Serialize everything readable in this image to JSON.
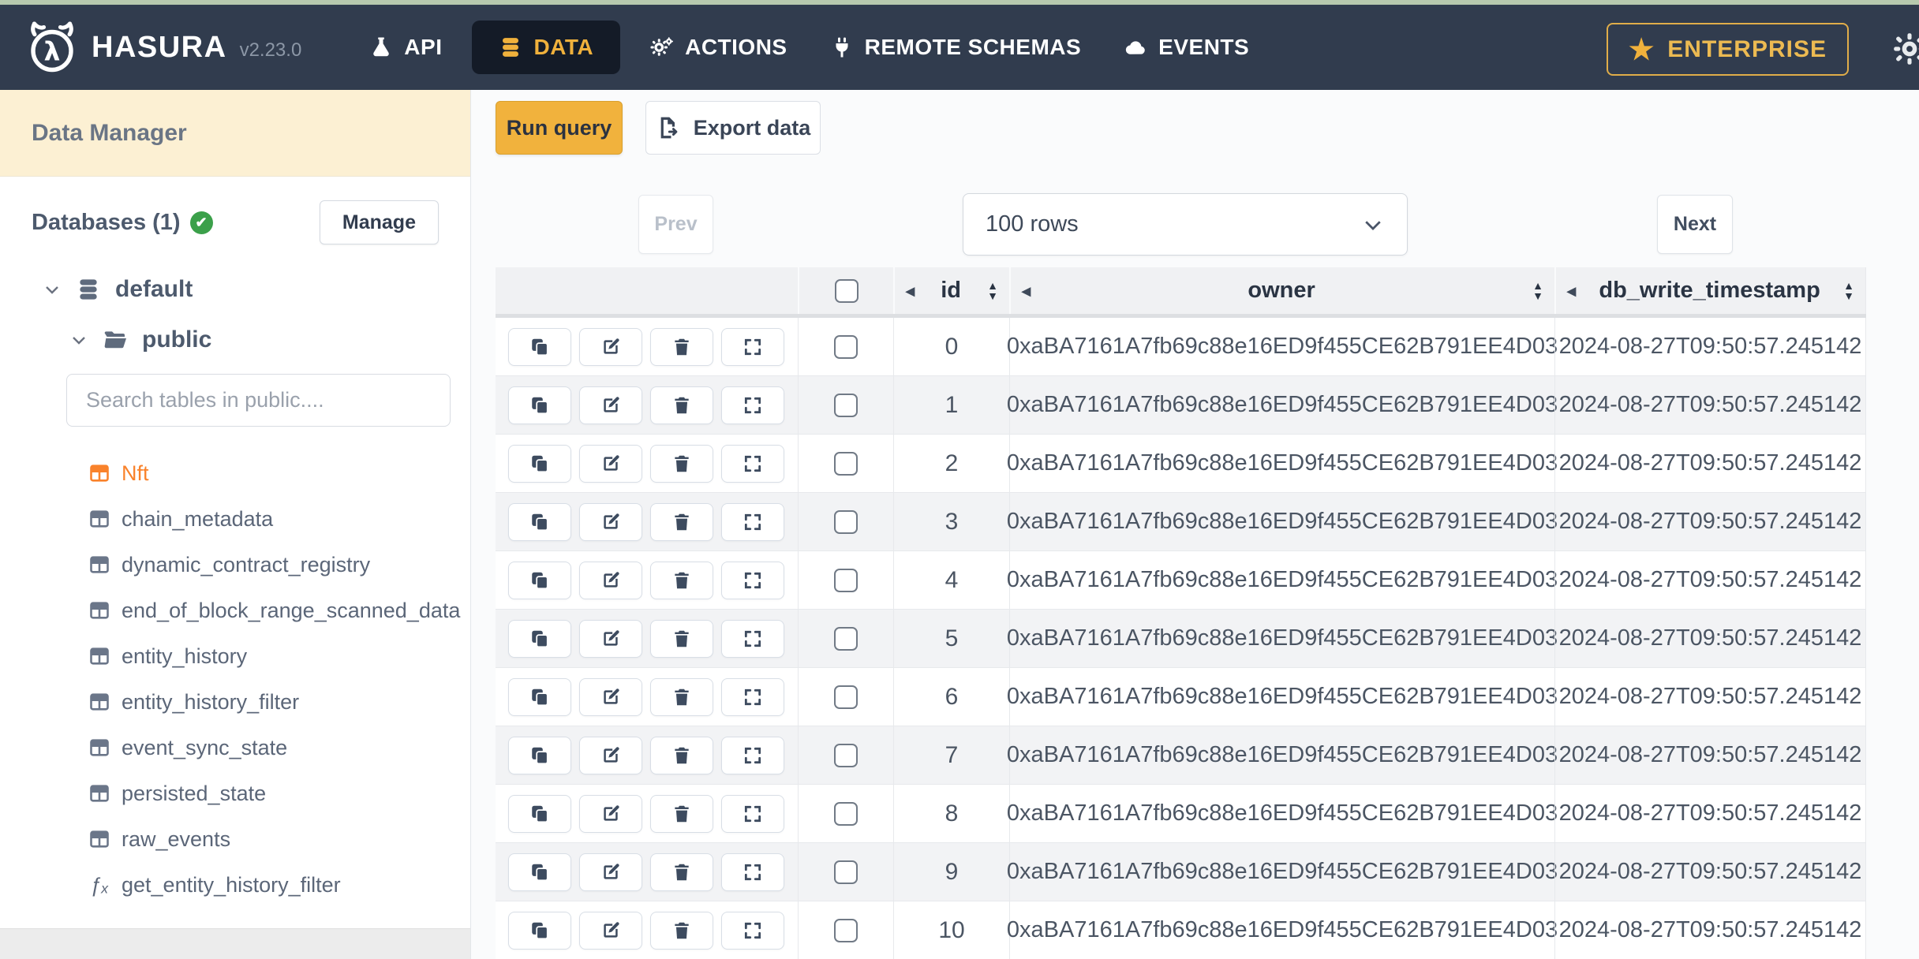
{
  "navbar": {
    "brand": "HASURA",
    "version": "v2.23.0",
    "items": [
      {
        "label": "API"
      },
      {
        "label": "DATA"
      },
      {
        "label": "ACTIONS"
      },
      {
        "label": "REMOTE SCHEMAS"
      },
      {
        "label": "EVENTS"
      }
    ],
    "enterprise_label": "ENTERPRISE"
  },
  "sidebar": {
    "title": "Data Manager",
    "databases_label": "Databases (1)",
    "manage_button": "Manage",
    "tree": {
      "database": "default",
      "schema": "public"
    },
    "search_placeholder": "Search tables in public....",
    "tables": [
      "Nft",
      "chain_metadata",
      "dynamic_contract_registry",
      "end_of_block_range_scanned_data",
      "entity_history",
      "entity_history_filter",
      "event_sync_state",
      "persisted_state",
      "raw_events"
    ],
    "selected_table": "Nft",
    "function_item": "get_entity_history_filter"
  },
  "toolbar": {
    "run_query": "Run query",
    "export_data": "Export data"
  },
  "pagination": {
    "prev": "Prev",
    "rows_select": "100 rows",
    "next": "Next"
  },
  "table": {
    "columns": [
      "id",
      "owner",
      "db_write_timestamp"
    ],
    "rows": [
      {
        "id": "0",
        "owner": "0xaBA7161A7fb69c88e16ED9f455CE62B791EE4D03",
        "db_write_timestamp": "2024-08-27T09:50:57.245142"
      },
      {
        "id": "1",
        "owner": "0xaBA7161A7fb69c88e16ED9f455CE62B791EE4D03",
        "db_write_timestamp": "2024-08-27T09:50:57.245142"
      },
      {
        "id": "2",
        "owner": "0xaBA7161A7fb69c88e16ED9f455CE62B791EE4D03",
        "db_write_timestamp": "2024-08-27T09:50:57.245142"
      },
      {
        "id": "3",
        "owner": "0xaBA7161A7fb69c88e16ED9f455CE62B791EE4D03",
        "db_write_timestamp": "2024-08-27T09:50:57.245142"
      },
      {
        "id": "4",
        "owner": "0xaBA7161A7fb69c88e16ED9f455CE62B791EE4D03",
        "db_write_timestamp": "2024-08-27T09:50:57.245142"
      },
      {
        "id": "5",
        "owner": "0xaBA7161A7fb69c88e16ED9f455CE62B791EE4D03",
        "db_write_timestamp": "2024-08-27T09:50:57.245142"
      },
      {
        "id": "6",
        "owner": "0xaBA7161A7fb69c88e16ED9f455CE62B791EE4D03",
        "db_write_timestamp": "2024-08-27T09:50:57.245142"
      },
      {
        "id": "7",
        "owner": "0xaBA7161A7fb69c88e16ED9f455CE62B791EE4D03",
        "db_write_timestamp": "2024-08-27T09:50:57.245142"
      },
      {
        "id": "8",
        "owner": "0xaBA7161A7fb69c88e16ED9f455CE62B791EE4D03",
        "db_write_timestamp": "2024-08-27T09:50:57.245142"
      },
      {
        "id": "9",
        "owner": "0xaBA7161A7fb69c88e16ED9f455CE62B791EE4D03",
        "db_write_timestamp": "2024-08-27T09:50:57.245142"
      },
      {
        "id": "10",
        "owner": "0xaBA7161A7fb69c88e16ED9f455CE62B791EE4D03",
        "db_write_timestamp": "2024-08-27T09:50:57.245142"
      }
    ]
  },
  "colors": {
    "accent_gold": "#f0b13c",
    "navbar_bg": "#313c4e",
    "active_tab_bg": "#141b27",
    "selected_table_orange": "#f9822b",
    "success_green": "#3ba04a",
    "sidebar_header_cream": "#fcf0d3"
  }
}
